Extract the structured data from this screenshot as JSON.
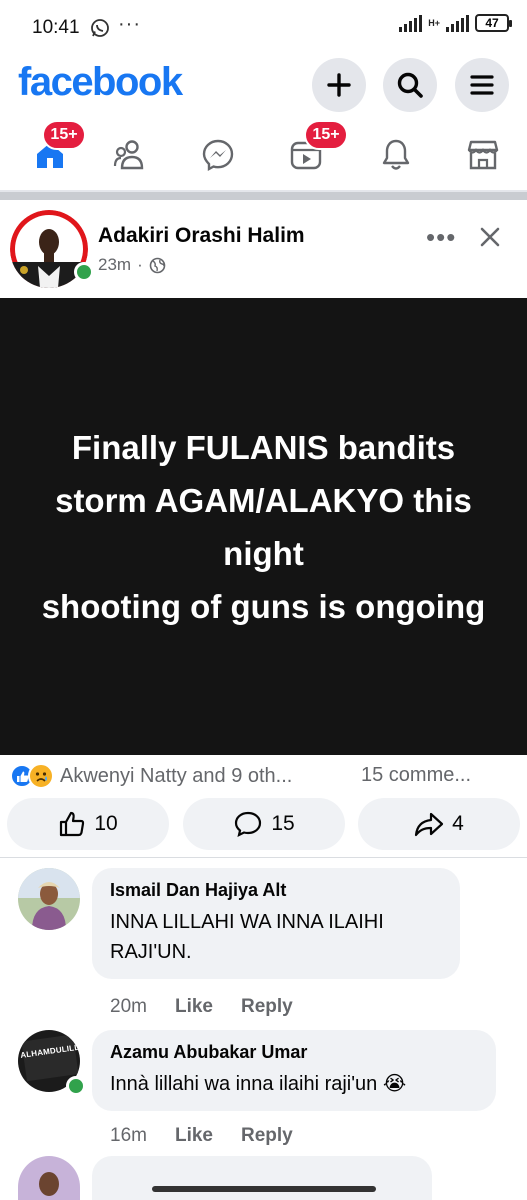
{
  "status_bar": {
    "time": "10:41",
    "dots": "···",
    "network": "H+",
    "battery": "47"
  },
  "header": {
    "logo": "facebook",
    "brand_color": "#1877f2",
    "buttons": [
      "plus-icon",
      "search-icon",
      "menu-icon"
    ]
  },
  "nav": {
    "home_badge": "15+",
    "video_badge": "15+",
    "items": [
      "home-icon",
      "friends-icon",
      "messenger-icon",
      "video-icon",
      "bell-icon",
      "marketplace-icon"
    ]
  },
  "post": {
    "author": "Adakiri Orashi Halim",
    "time": "23m",
    "privacy_icon": "globe-icon",
    "more": "•••",
    "text_lines": [
      "Finally FULANIS bandits",
      "storm AGAM/ALAKYO this",
      "night",
      "shooting of guns is ongoing"
    ],
    "background_color": "#141414",
    "reactions_text": "Akwenyi Natty and 9 oth...",
    "comments_text": "15 comme...",
    "like_count": "10",
    "comment_count": "15",
    "share_count": "4"
  },
  "comments": [
    {
      "name": "Ismail Dan Hajiya Alt",
      "text_lines": [
        "INNA LILLAHI WA INNA ILAIHI",
        "RAJI'UN."
      ],
      "time": "20m",
      "like": "Like",
      "reply": "Reply"
    },
    {
      "name": "Azamu Abubakar Umar",
      "text": "Innà lillahi wa inna ilaihi raji'un",
      "emoji": "😭",
      "avatar_text": "ALHAMDULILLAH",
      "time": "16m",
      "like": "Like",
      "reply": "Reply"
    }
  ]
}
